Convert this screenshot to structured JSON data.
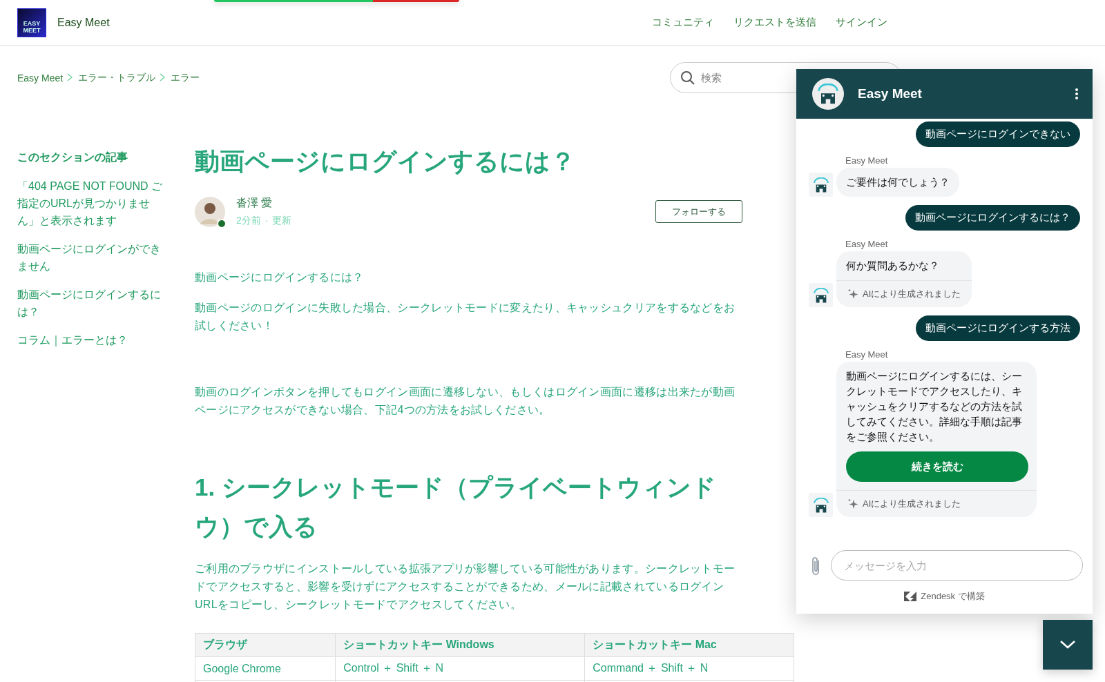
{
  "header": {
    "logo_lines": [
      "EASY",
      "MEET"
    ],
    "site_name": "Easy Meet",
    "nav": [
      "コミュニティ",
      "リクエストを送信",
      "サインイン"
    ]
  },
  "breadcrumb": [
    "Easy Meet",
    "エラー・トラブル",
    "エラー"
  ],
  "search": {
    "placeholder": "検索"
  },
  "sidebar": {
    "heading": "このセクションの記事",
    "items": [
      "「404 PAGE NOT FOUND ご指定のURLが見つかりません」と表示されます",
      "動画ページにログインができません",
      "動画ページにログインするには？",
      "コラム｜エラーとは？"
    ]
  },
  "article": {
    "title": "動画ページにログインするには？",
    "author": {
      "name": "沓澤 愛",
      "time": "2分前",
      "separator": "·",
      "updated": "更新"
    },
    "follow_button": "フォローする",
    "blocks": [
      {
        "kind": "paragraph",
        "text": "動画ページにログインするには？"
      },
      {
        "kind": "paragraph",
        "text": "動画ページのログインに失敗した場合、シークレットモードに変えたり、キャッシュクリアをするなどをお試しください！"
      },
      {
        "kind": "paragraph",
        "text": "動画のログインボタンを押してもログイン画面に遷移しない、もしくはログイン画面に遷移は出来たが動画ページにアクセスができない場合、下記4つの方法をお試しください。"
      },
      {
        "kind": "heading",
        "text": "1. シークレットモード（プライベートウィンドウ）で入る"
      },
      {
        "kind": "paragraph",
        "text": "ご利用のブラウザにインストールしている拡張アプリが影響している可能性があります。シークレットモードでアクセスすると、影響を受けずにアクセスすることができるため、メールに記載されているログインURLをコピーし、シークレットモードでアクセスしてください。"
      },
      {
        "kind": "table",
        "columns": [
          "ブラウザ",
          "ショートカットキー Windows",
          "ショートカットキー Mac"
        ],
        "rows": [
          [
            "Google Chrome",
            "Control ＋ Shift ＋ N",
            "Command ＋ Shift ＋ N"
          ]
        ]
      }
    ]
  },
  "chat": {
    "title": "Easy Meet",
    "messages": [
      {
        "kind": "user",
        "text": "動画ページにログインできない"
      },
      {
        "kind": "bot",
        "sender": "Easy Meet",
        "text": "ご要件は何でしょう？"
      },
      {
        "kind": "user",
        "text": "動画ページにログインするには？"
      },
      {
        "kind": "bot",
        "sender": "Easy Meet",
        "text": "何か質問あるかな？",
        "ai_note": "AIにより生成されました"
      },
      {
        "kind": "user",
        "text": "動画ページにログインする方法"
      },
      {
        "kind": "bot",
        "sender": "Easy Meet",
        "text": "動画ページにログインするには、シークレットモードでアクセスしたり、キャッシュをクリアするなどの方法を試してみてください。詳細な手順は記事をご参照ください。",
        "button": "続きを読む",
        "ai_note": "AIにより生成されました"
      }
    ],
    "input_placeholder": "メッセージを入力",
    "footer": "Zendesk で構築"
  }
}
